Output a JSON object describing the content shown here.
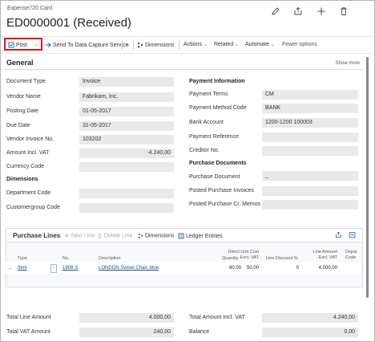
{
  "header": {
    "card_label": "Expense720 Card",
    "title": "ED0000001 (Received)"
  },
  "actions": {
    "post": "Post",
    "send": "Send To Data Capture Service",
    "dimensions": "Dimensions",
    "actions": "Actions",
    "related": "Related",
    "automate": "Automate",
    "fewer": "Fewer options"
  },
  "general": {
    "title": "General",
    "show_more": "Show more",
    "left": [
      {
        "label": "Document Type",
        "value": "Invoice"
      },
      {
        "label": "Vendor Name",
        "value": "Fabrikam, Inc."
      },
      {
        "label": "Posting Date",
        "value": "01-05-2017"
      },
      {
        "label": "Due Date",
        "value": "31-05-2017"
      },
      {
        "label": "Vendor Invoice No.",
        "value": "103202"
      },
      {
        "label": "Amount Incl. VAT",
        "value": "-4.240,00"
      },
      {
        "label": "Currency Code",
        "value": ""
      }
    ],
    "dimensions_group": "Dimensions",
    "dims": [
      {
        "label": "Department Code",
        "value": ""
      },
      {
        "label": "Customergroup Code",
        "value": ""
      }
    ],
    "payment_group": "Payment Information",
    "payment": [
      {
        "label": "Payment Terms",
        "value": "CM"
      },
      {
        "label": "Payment Method Code",
        "value": "BANK"
      },
      {
        "label": "Bank Account",
        "value": "1200-1200 100003"
      },
      {
        "label": "Payment Reference",
        "value": ""
      },
      {
        "label": "Creditor No.",
        "value": ""
      }
    ],
    "purchase_group": "Purchase Documents",
    "purchase": [
      {
        "label": "Purchase Document",
        "value": "_"
      },
      {
        "label": "Posted Purchase Invoices",
        "value": ""
      },
      {
        "label": "Posted Purchase Cr. Memos",
        "value": ""
      }
    ]
  },
  "lines": {
    "title": "Purchase Lines",
    "new_line": "New Line",
    "delete_line": "Delete Line",
    "dimensions": "Dimensions",
    "ledger": "Ledger Entries",
    "headers": {
      "type": "Type",
      "no": "No.",
      "description": "Description",
      "quantity": "Quantity",
      "unit_cost_1": "Direct Unit Cost",
      "unit_cost_2": "Excl. VAT",
      "discount": "Line Discount %",
      "amount_1": "Line Amount",
      "amount_2": "Excl. VAT",
      "dept_1": "Depar",
      "dept_2": "Code"
    },
    "row": {
      "type": "Item",
      "no": "1908-S",
      "description": "LONDON Swivel Chair, blue",
      "quantity": "80,00",
      "unit_cost": "50,00",
      "discount": "0",
      "amount": "4.000,00"
    }
  },
  "totals": {
    "total_line_label": "Total Line Amount",
    "total_line_value": "4.000,00",
    "total_vat_label": "Total VAT Amount",
    "total_vat_value": "240,00",
    "total_incl_label": "Total Amount Incl. VAT",
    "total_incl_value": "4.240,00",
    "balance_label": "Balance",
    "balance_value": "0,00"
  }
}
